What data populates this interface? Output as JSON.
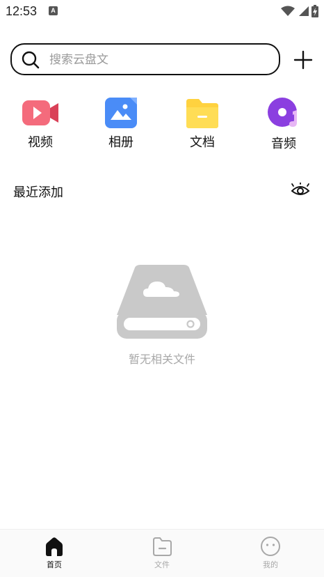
{
  "status_bar": {
    "time": "12:53",
    "notification_badge": "A"
  },
  "search": {
    "placeholder": "搜索云盘文",
    "value": ""
  },
  "categories": [
    {
      "label": "视频",
      "icon": "video-icon",
      "color": "#F05A6E"
    },
    {
      "label": "相册",
      "icon": "photo-album-icon",
      "color": "#4A8CF7"
    },
    {
      "label": "文档",
      "icon": "document-folder-icon",
      "color": "#FFD23F"
    },
    {
      "label": "音频",
      "icon": "audio-disc-icon",
      "color": "#8B3FE0"
    }
  ],
  "recent": {
    "title": "最近添加",
    "empty_text": "暂无相关文件"
  },
  "bottom_nav": {
    "items": [
      {
        "label": "首页",
        "icon": "home-icon",
        "active": true
      },
      {
        "label": "文件",
        "icon": "files-icon",
        "active": false
      },
      {
        "label": "我的",
        "icon": "profile-icon",
        "active": false
      }
    ]
  },
  "colors": {
    "text": "#111111",
    "muted": "#a8a8a8",
    "illustration": "#c9c9c9"
  }
}
